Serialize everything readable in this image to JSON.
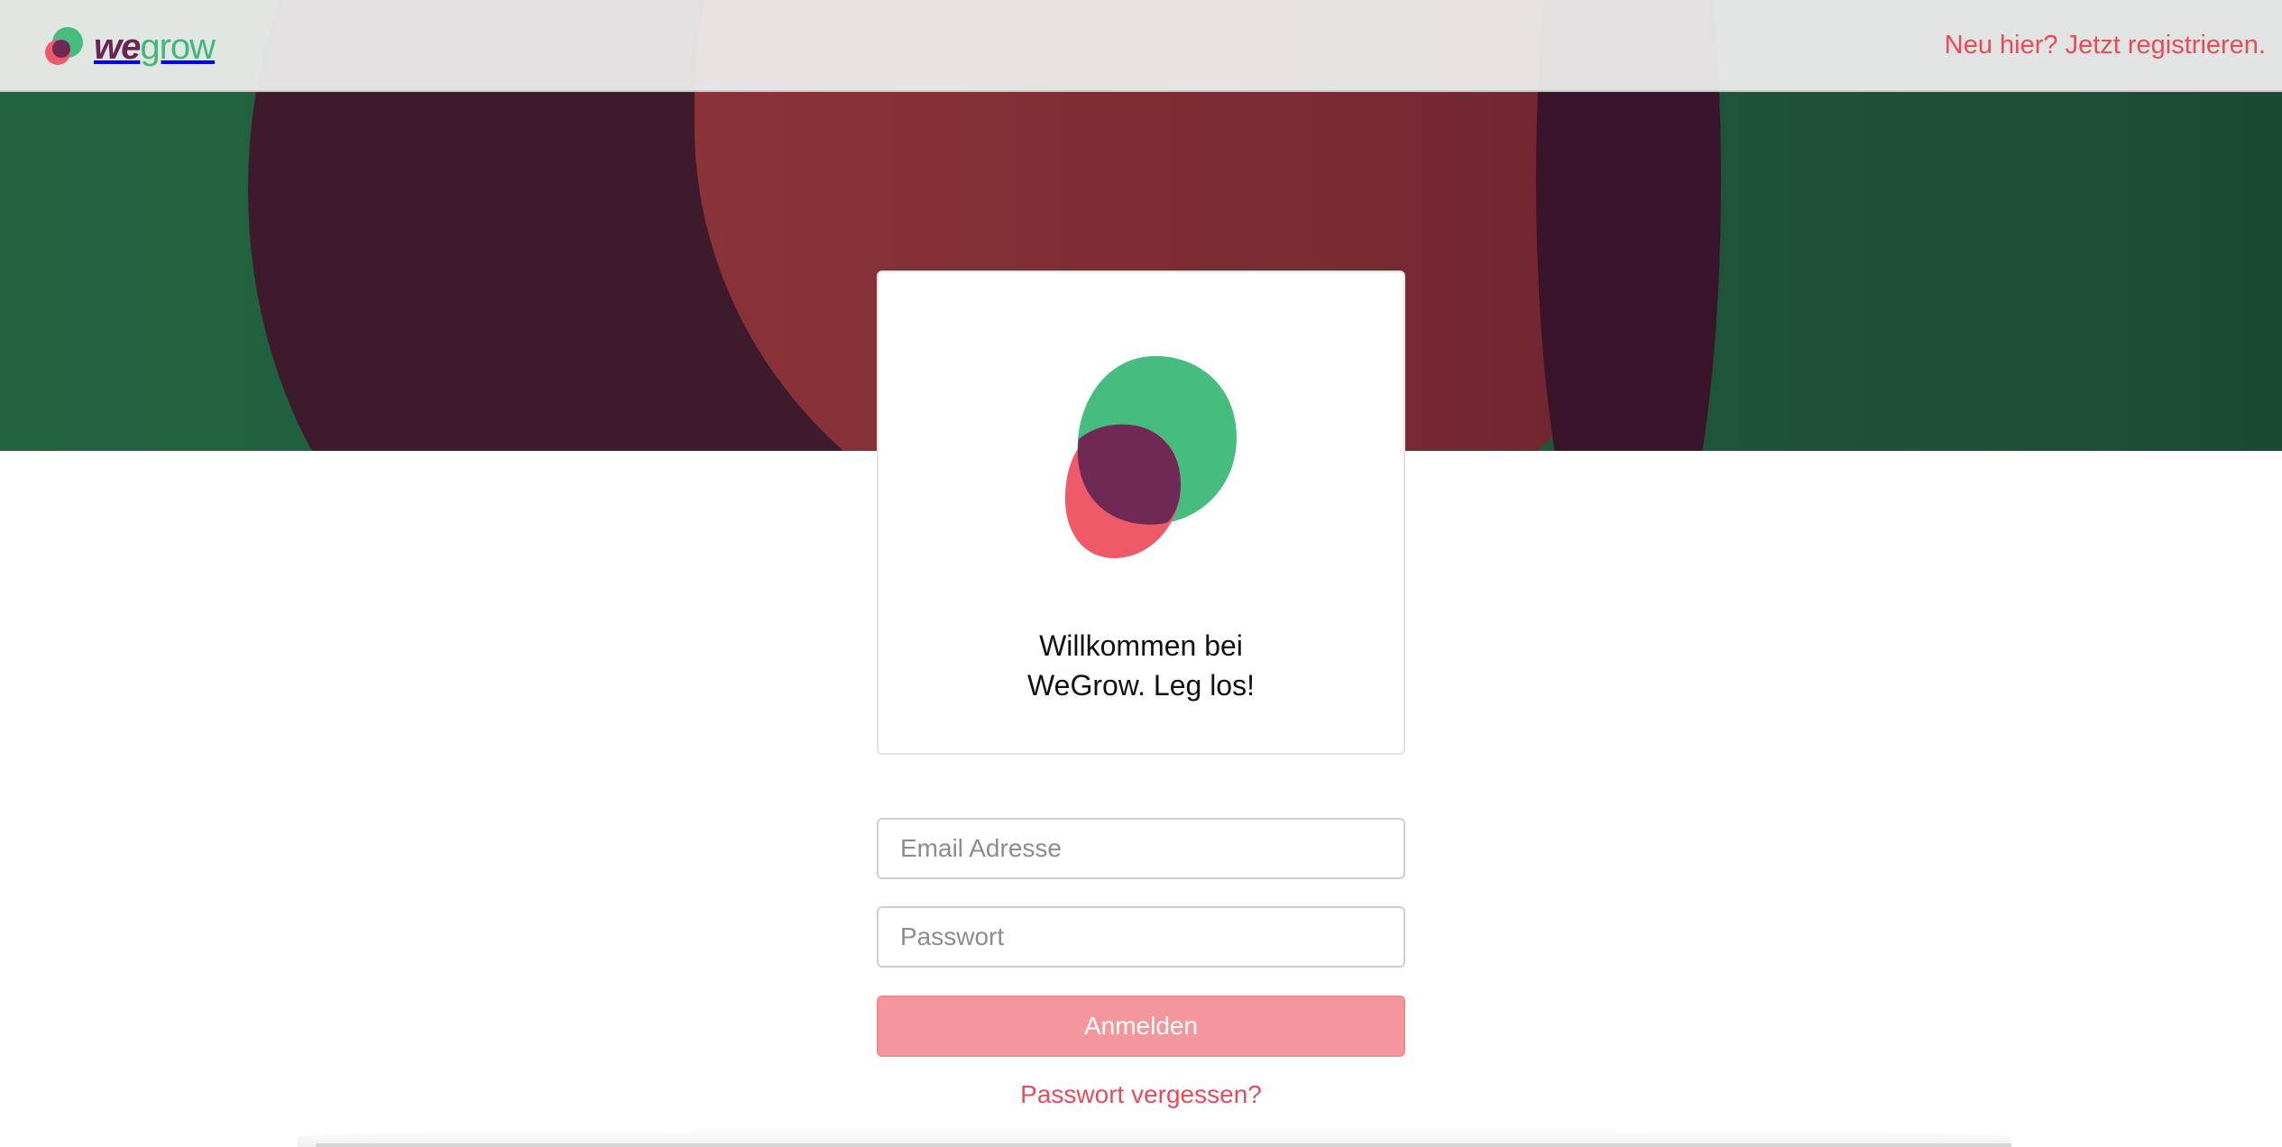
{
  "brand": {
    "name_part1": "we",
    "name_part2": "grow",
    "colors": {
      "green": "#46bd7e",
      "red": "#ef5a68",
      "purple": "#6e2a55"
    }
  },
  "topbar": {
    "register_link": "Neu hier? Jetzt registrieren."
  },
  "card": {
    "title_line1": "Willkommen bei",
    "title_line2": "WeGrow. Leg los!",
    "logo_icon": "wegrow-logo-icon"
  },
  "form": {
    "email_placeholder": "Email Adresse",
    "email_value": "",
    "password_placeholder": "Passwort",
    "password_value": "",
    "submit_label": "Anmelden",
    "forgot_link": "Passwort vergessen?"
  },
  "theme": {
    "accent": "#ea4a5a",
    "button_bg": "#f5969d",
    "hero_green": "#236340",
    "hero_red": "#8b3339",
    "hero_purple": "#3e1a2d"
  }
}
